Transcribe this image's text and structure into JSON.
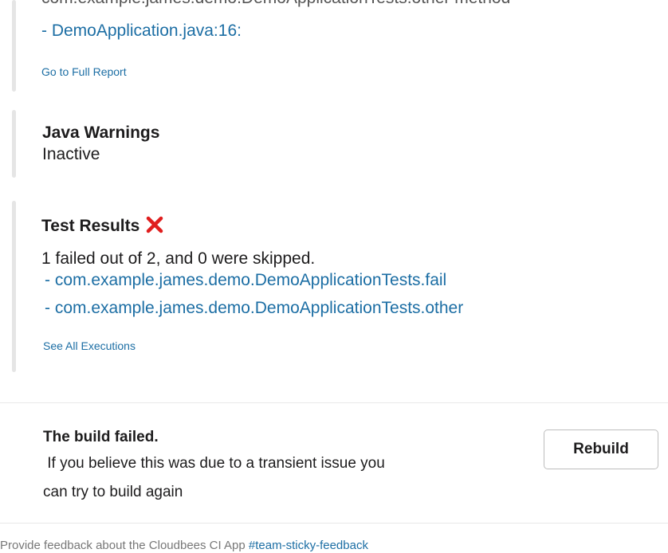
{
  "top": {
    "clipped_text": "com.example.james.demo.DemoApplicationTests.other method",
    "link_line": "- DemoApplication.java:16:",
    "full_report": "Go to Full Report"
  },
  "java_warnings": {
    "title": "Java Warnings",
    "status": "Inactive"
  },
  "test_results": {
    "title": "Test Results",
    "status_icon": "red-x-icon",
    "summary": "1 failed out of 2, and 0 were skipped.",
    "tests": [
      "- com.example.james.demo.DemoApplicationTests.fail",
      "- com.example.james.demo.DemoApplicationTests.other"
    ],
    "see_all": "See All Executions"
  },
  "build": {
    "title": "The build failed.",
    "line1": " If you believe this was due to a transient issue you",
    "line2": "can try to build again",
    "rebuild": "Rebuild"
  },
  "footer": {
    "text": "Provide feedback about the Cloudbees CI App ",
    "channel": "#team-sticky-feedback"
  },
  "colors": {
    "link": "#1c6ea4",
    "error": "#e01e1e",
    "sidebar_bar": "#e5e5e5"
  }
}
